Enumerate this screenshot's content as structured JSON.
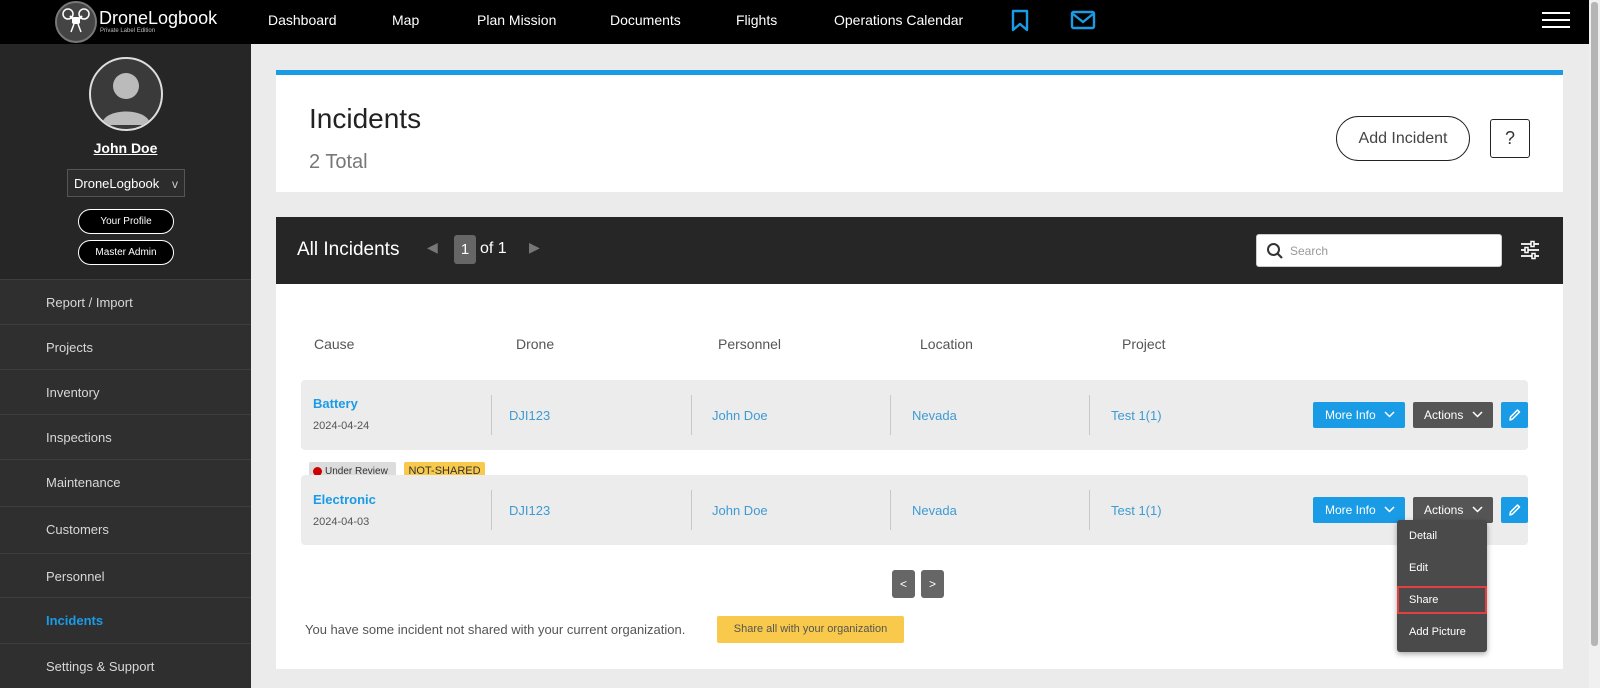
{
  "brand": {
    "name": "DroneLogbook",
    "subtitle": "Private Label Edition"
  },
  "nav": {
    "items": [
      "Dashboard",
      "Map",
      "Plan Mission",
      "Documents",
      "Flights",
      "Operations Calendar"
    ],
    "icons": [
      "bookmark-icon",
      "mail-icon",
      "hamburger-menu-icon"
    ]
  },
  "sidebar": {
    "user_name": "John Doe",
    "org": "DroneLogbook",
    "org_chevron": "v",
    "buttons": [
      "Your Profile",
      "Master Admin"
    ],
    "items": [
      {
        "label": "Report / Import",
        "active": false
      },
      {
        "label": "Projects",
        "active": false
      },
      {
        "label": "Inventory",
        "active": false
      },
      {
        "label": "Inspections",
        "active": false
      },
      {
        "label": "Maintenance",
        "active": false
      },
      {
        "label": "Customers",
        "active": false
      },
      {
        "label": "Personnel",
        "active": false
      },
      {
        "label": "Incidents",
        "active": true
      },
      {
        "label": "Settings & Support",
        "active": false
      }
    ]
  },
  "header": {
    "title": "Incidents",
    "total": "2 Total",
    "add_button": "Add Incident",
    "help_button": "?"
  },
  "panel": {
    "title": "All Incidents",
    "page_current": "1",
    "page_of": "of 1",
    "search_placeholder": "Search",
    "columns": [
      "Cause",
      "Drone",
      "Personnel",
      "Location",
      "Project"
    ],
    "rows": [
      {
        "cause": "Battery",
        "date": "2024-04-24",
        "drone": "DJI123",
        "personnel": "John Doe",
        "location": "Nevada",
        "project": "Test 1(1)"
      },
      {
        "cause": "Electronic",
        "date": "2024-04-03",
        "drone": "DJI123",
        "personnel": "John Doe",
        "location": "Nevada",
        "project": "Test 1(1)",
        "status": "Under Review",
        "share_status": "NOT-SHARED"
      }
    ],
    "more_info_label": "More Info",
    "actions_label": "Actions",
    "actions_menu": [
      "Detail",
      "Edit",
      "Share",
      "Add Picture"
    ],
    "pager": [
      "<",
      ">"
    ],
    "notice": "You have some incident not shared with your current organization.",
    "share_all_button": "Share all with your organization"
  },
  "colors": {
    "accent": "#1a9be6",
    "warning": "#f8c94a",
    "dark": "#262626",
    "status_red": "#cc0000",
    "highlight": "#e04040"
  }
}
